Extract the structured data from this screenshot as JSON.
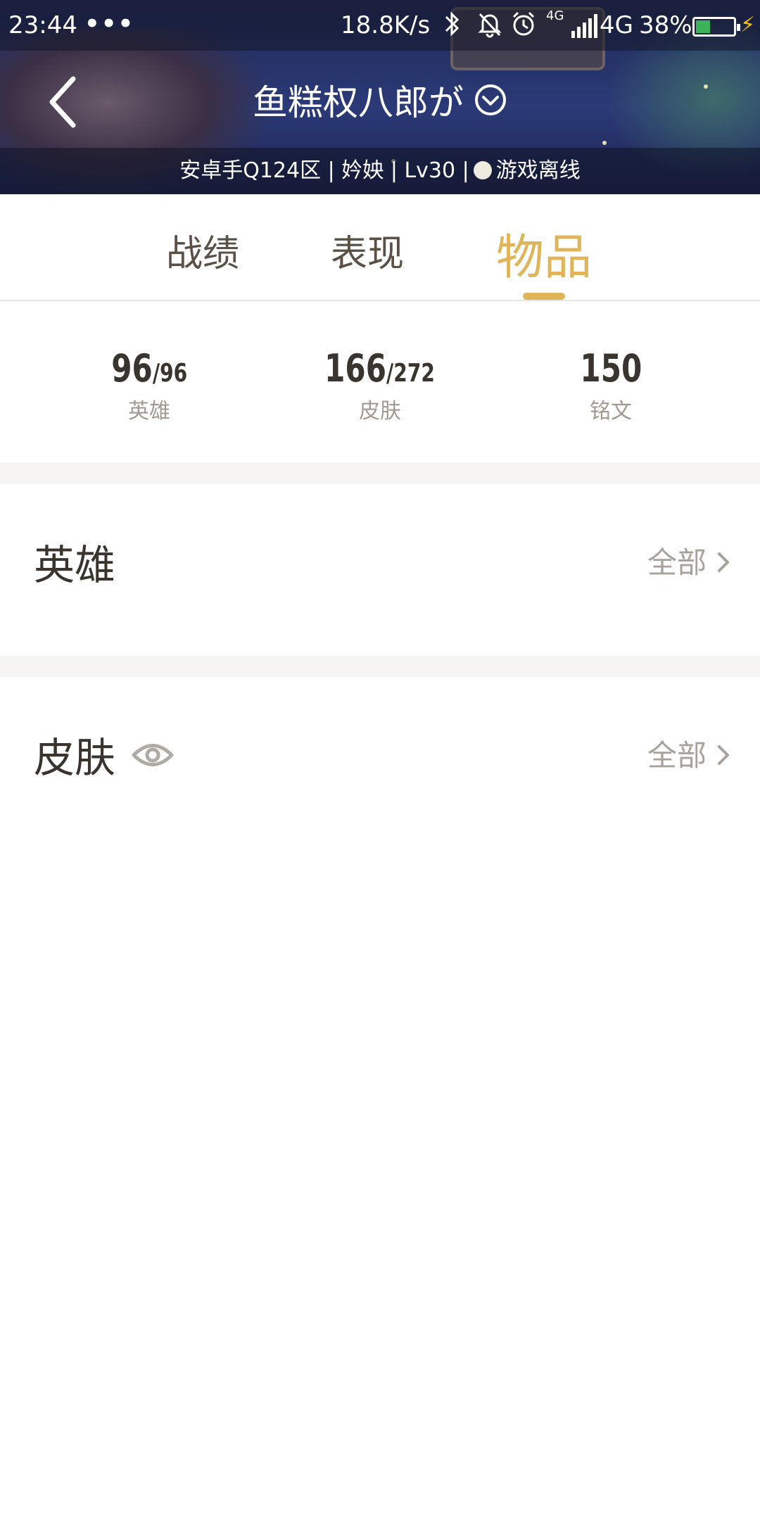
{
  "status_bar": {
    "time": "23:44",
    "more": "•••",
    "net_speed": "18.8K/s",
    "net_type": "4G",
    "net_small": "4G",
    "battery_percent": "38%",
    "battery_level": 0.38,
    "icons": [
      "bluetooth-icon",
      "bell-off-icon",
      "alarm-icon",
      "signal-icon",
      "battery-icon",
      "charging-icon"
    ]
  },
  "header": {
    "title": "鱼糕权八郎が",
    "info_before_dot": "安卓手Q124区 | 妗姎 | Lv30 |",
    "status": "游戏离线"
  },
  "tabs": [
    {
      "label": "战绩",
      "active": false
    },
    {
      "label": "表现",
      "active": false
    },
    {
      "label": "物品",
      "active": true
    }
  ],
  "stats": [
    {
      "value": "96",
      "total": "/96",
      "label": "英雄"
    },
    {
      "value": "166",
      "total": "/272",
      "label": "皮肤"
    },
    {
      "value": "150",
      "total": "",
      "label": "铭文"
    }
  ],
  "sections": {
    "heroes": {
      "title": "英雄",
      "link": "全部"
    },
    "skins": {
      "title": "皮肤",
      "link": "全部"
    }
  },
  "colors": {
    "accent": "#e0b559",
    "text_dark": "#3a342e",
    "text_muted": "#a8a29c"
  }
}
